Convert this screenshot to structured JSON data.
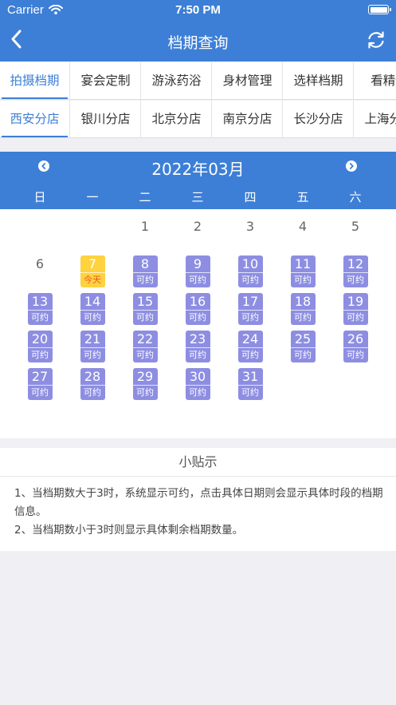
{
  "status_bar": {
    "carrier": "Carrier",
    "time": "7:50 PM"
  },
  "nav": {
    "title": "档期查询",
    "back_icon": "chevron-left-icon",
    "refresh_icon": "refresh-icon"
  },
  "category_tabs": [
    "拍摄档期",
    "宴会定制",
    "游泳药浴",
    "身材管理",
    "选样档期",
    "看精修"
  ],
  "active_category": 0,
  "store_tabs": [
    "西安分店",
    "银川分店",
    "北京分店",
    "南京分店",
    "长沙分店",
    "上海分店"
  ],
  "active_store": 0,
  "calendar": {
    "month_title": "2022年03月",
    "weekdays": [
      "日",
      "一",
      "二",
      "三",
      "四",
      "五",
      "六"
    ],
    "leading_days": [
      {
        "day": "1",
        "col": 2
      },
      {
        "day": "2",
        "col": 3
      },
      {
        "day": "3",
        "col": 4
      },
      {
        "day": "4",
        "col": 5
      },
      {
        "day": "5",
        "col": 6
      },
      {
        "day": "6",
        "col": 0,
        "row": 1
      }
    ],
    "today": {
      "day": "7",
      "label": "今天"
    },
    "available_label": "可约",
    "available_days": [
      "8",
      "9",
      "10",
      "11",
      "12",
      "13",
      "14",
      "15",
      "16",
      "17",
      "18",
      "19",
      "20",
      "21",
      "22",
      "23",
      "24",
      "25",
      "26",
      "27",
      "28",
      "29",
      "30",
      "31"
    ],
    "colors": {
      "available": "#8d8ee2",
      "today": "#ffd23f",
      "today_text": "#e8562a",
      "brand": "#3d7fd6"
    }
  },
  "tips": {
    "title": "小贴示",
    "line1": "1、当档期数大于3时，系统显示可约，点击具体日期则会显示具体时段的档期信息。",
    "line2": "2、当档期数小于3时则显示具体剩余档期数量。"
  }
}
